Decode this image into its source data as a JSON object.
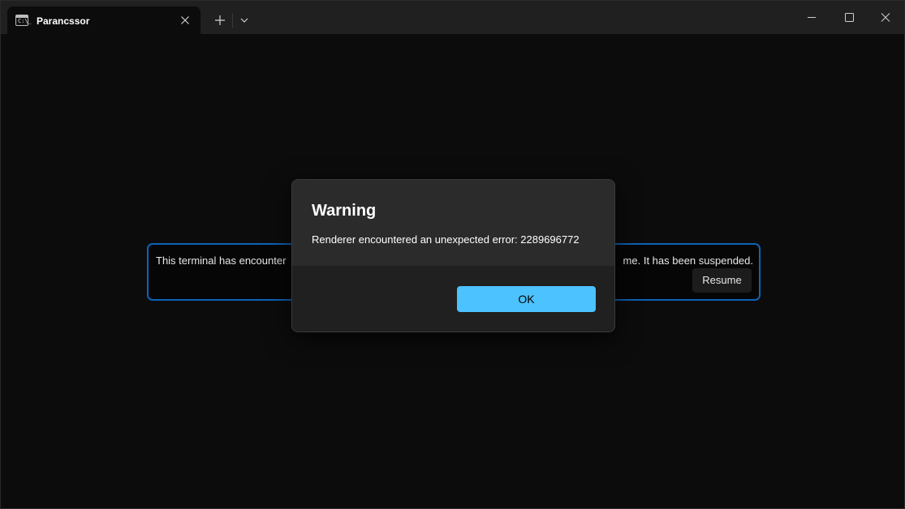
{
  "titlebar": {
    "tab_title": "Parancssor",
    "tab_icon_glyph": "C:\\_",
    "tab_icon": "terminal-icon",
    "close_tab_icon": "close-icon",
    "new_tab_icon": "plus-icon",
    "dropdown_icon": "chevron-down-icon",
    "window_controls": [
      "minimize-icon",
      "maximize-icon",
      "close-icon"
    ]
  },
  "infobar": {
    "text_left": "This terminal has encounter",
    "text_right": "me. It has been suspended.",
    "resume_label": "Resume"
  },
  "dialog": {
    "title": "Warning",
    "message": "Renderer encountered an unexpected error: 2289696772",
    "ok_label": "OK"
  },
  "colors": {
    "background": "#0c0c0c",
    "titlebar": "#202020",
    "accent": "#4cc2ff",
    "infobar_border": "#0e63b8"
  }
}
